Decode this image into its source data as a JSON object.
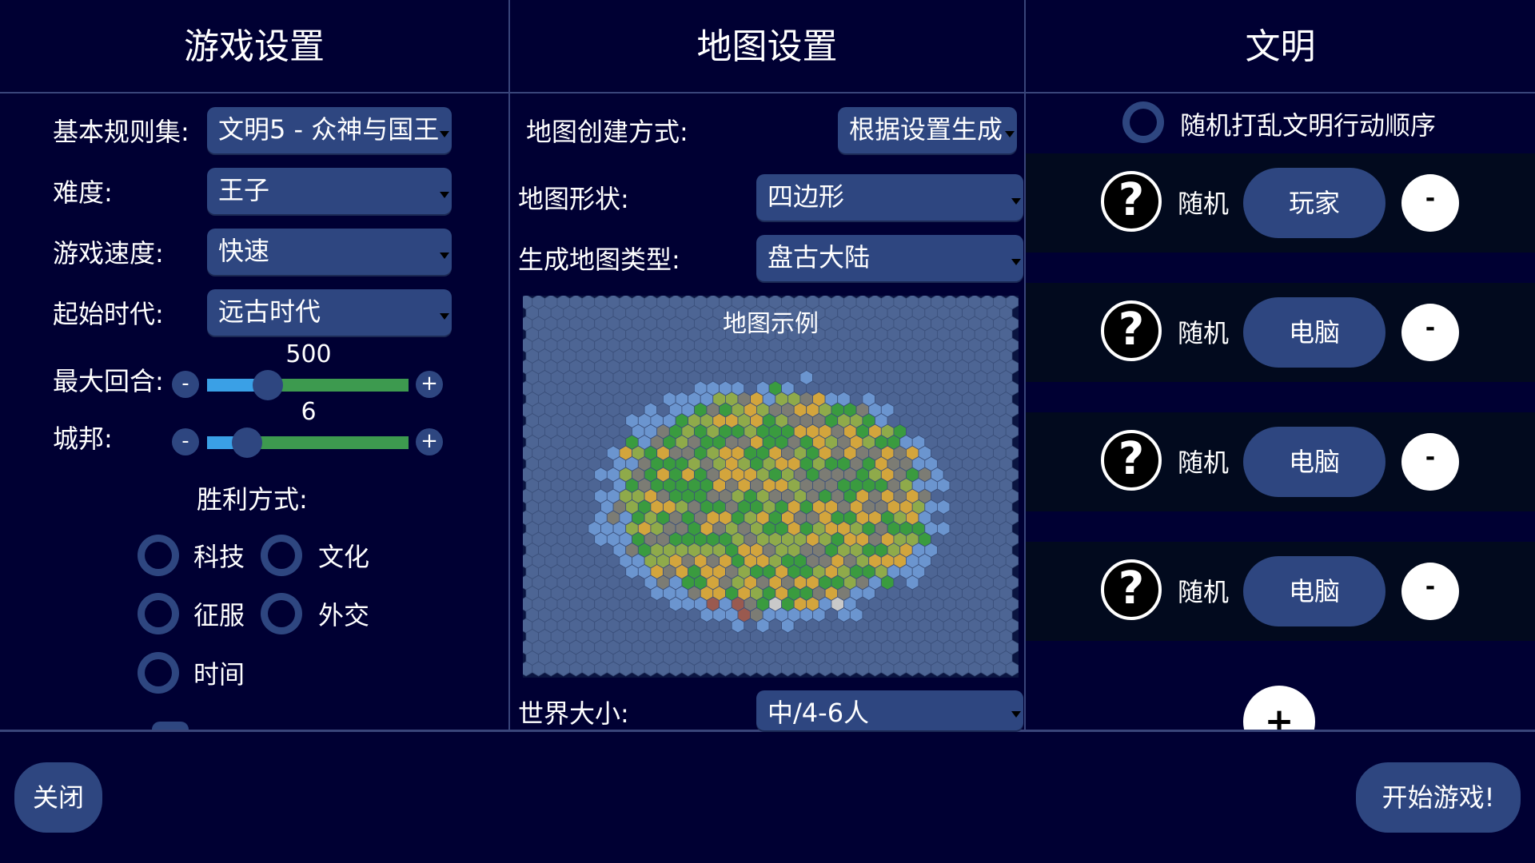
{
  "columns": {
    "game": "游戏设置",
    "map": "地图设置",
    "civ": "文明"
  },
  "game_settings": {
    "ruleset_label": "基本规则集:",
    "ruleset_value": "文明5 - 众神与国王",
    "difficulty_label": "难度:",
    "difficulty_value": "王子",
    "speed_label": "游戏速度:",
    "speed_value": "快速",
    "era_label": "起始时代:",
    "era_value": "远古时代",
    "max_turns_label": "最大回合:",
    "max_turns_value": "500",
    "max_turns_level": 0.3,
    "city_states_label": "城邦:",
    "city_states_value": "6",
    "city_states_level": 0.2,
    "minus": "-",
    "plus": "+",
    "victory_label": "胜利方式:",
    "victories": [
      "科技",
      "文化",
      "征服",
      "外交",
      "时间"
    ]
  },
  "map_settings": {
    "creation_label": "地图创建方式:",
    "creation_value": "根据设置生成",
    "shape_label": "地图形状:",
    "shape_value": "四边形",
    "type_label": "生成地图类型:",
    "type_value": "盘古大陆",
    "preview_label": "地图示例",
    "size_label": "世界大小:",
    "size_value": "中/4-6人"
  },
  "civs": {
    "shuffle_label": "随机打乱文明行动顺序",
    "question": "?",
    "minus": "-",
    "add": "+",
    "rows": [
      {
        "name": "随机",
        "player": "玩家"
      },
      {
        "name": "随机",
        "player": "电脑"
      },
      {
        "name": "随机",
        "player": "电脑"
      },
      {
        "name": "随机",
        "player": "电脑"
      }
    ]
  },
  "footer": {
    "close": "关闭",
    "start": "开始游戏!"
  },
  "colors": {
    "background": "#000033",
    "button": "#2e4680",
    "slider_fill": "#3aa0e6",
    "slider_track": "#3d9a4f"
  }
}
